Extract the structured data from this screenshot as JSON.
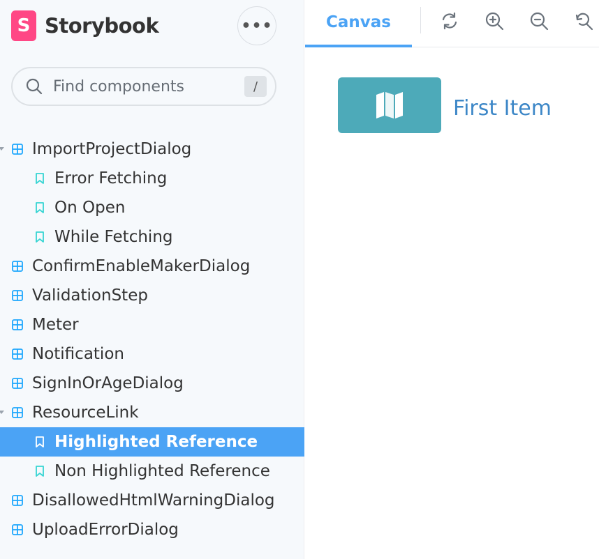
{
  "brand": {
    "logo_letter": "S",
    "name": "Storybook"
  },
  "menu": {
    "label": "•••",
    "icon": "ellipsis-icon"
  },
  "search": {
    "placeholder": "Find components",
    "shortcut": "/"
  },
  "tree": [
    {
      "label": "ImportProjectDialog",
      "kind": "component",
      "expanded": true
    },
    {
      "label": "Error Fetching",
      "kind": "story"
    },
    {
      "label": "On Open",
      "kind": "story"
    },
    {
      "label": "While Fetching",
      "kind": "story"
    },
    {
      "label": "ConfirmEnableMakerDialog",
      "kind": "component"
    },
    {
      "label": "ValidationStep",
      "kind": "component"
    },
    {
      "label": "Meter",
      "kind": "component"
    },
    {
      "label": "Notification",
      "kind": "component"
    },
    {
      "label": "SignInOrAgeDialog",
      "kind": "component"
    },
    {
      "label": "ResourceLink",
      "kind": "component",
      "expanded": true
    },
    {
      "label": "Highlighted Reference",
      "kind": "story",
      "selected": true
    },
    {
      "label": "Non Highlighted Reference",
      "kind": "story"
    },
    {
      "label": "DisallowedHtmlWarningDialog",
      "kind": "component"
    },
    {
      "label": "UploadErrorDialog",
      "kind": "component"
    }
  ],
  "toolbar": {
    "active_tab": "Canvas",
    "tools": [
      "reload-icon",
      "zoom-in-icon",
      "zoom-out-icon",
      "zoom-reset-icon"
    ]
  },
  "canvas": {
    "item_title": "First Item",
    "item_icon": "map-icon"
  },
  "colors": {
    "accent": "#4ba3f5",
    "brand_pink": "#ff4785",
    "sidebar_bg": "#f6f9fc",
    "card_teal": "#4daab9",
    "item_title": "#3d87c7",
    "story_icon": "#37d5d3",
    "component_icon": "#1ea7fd"
  }
}
